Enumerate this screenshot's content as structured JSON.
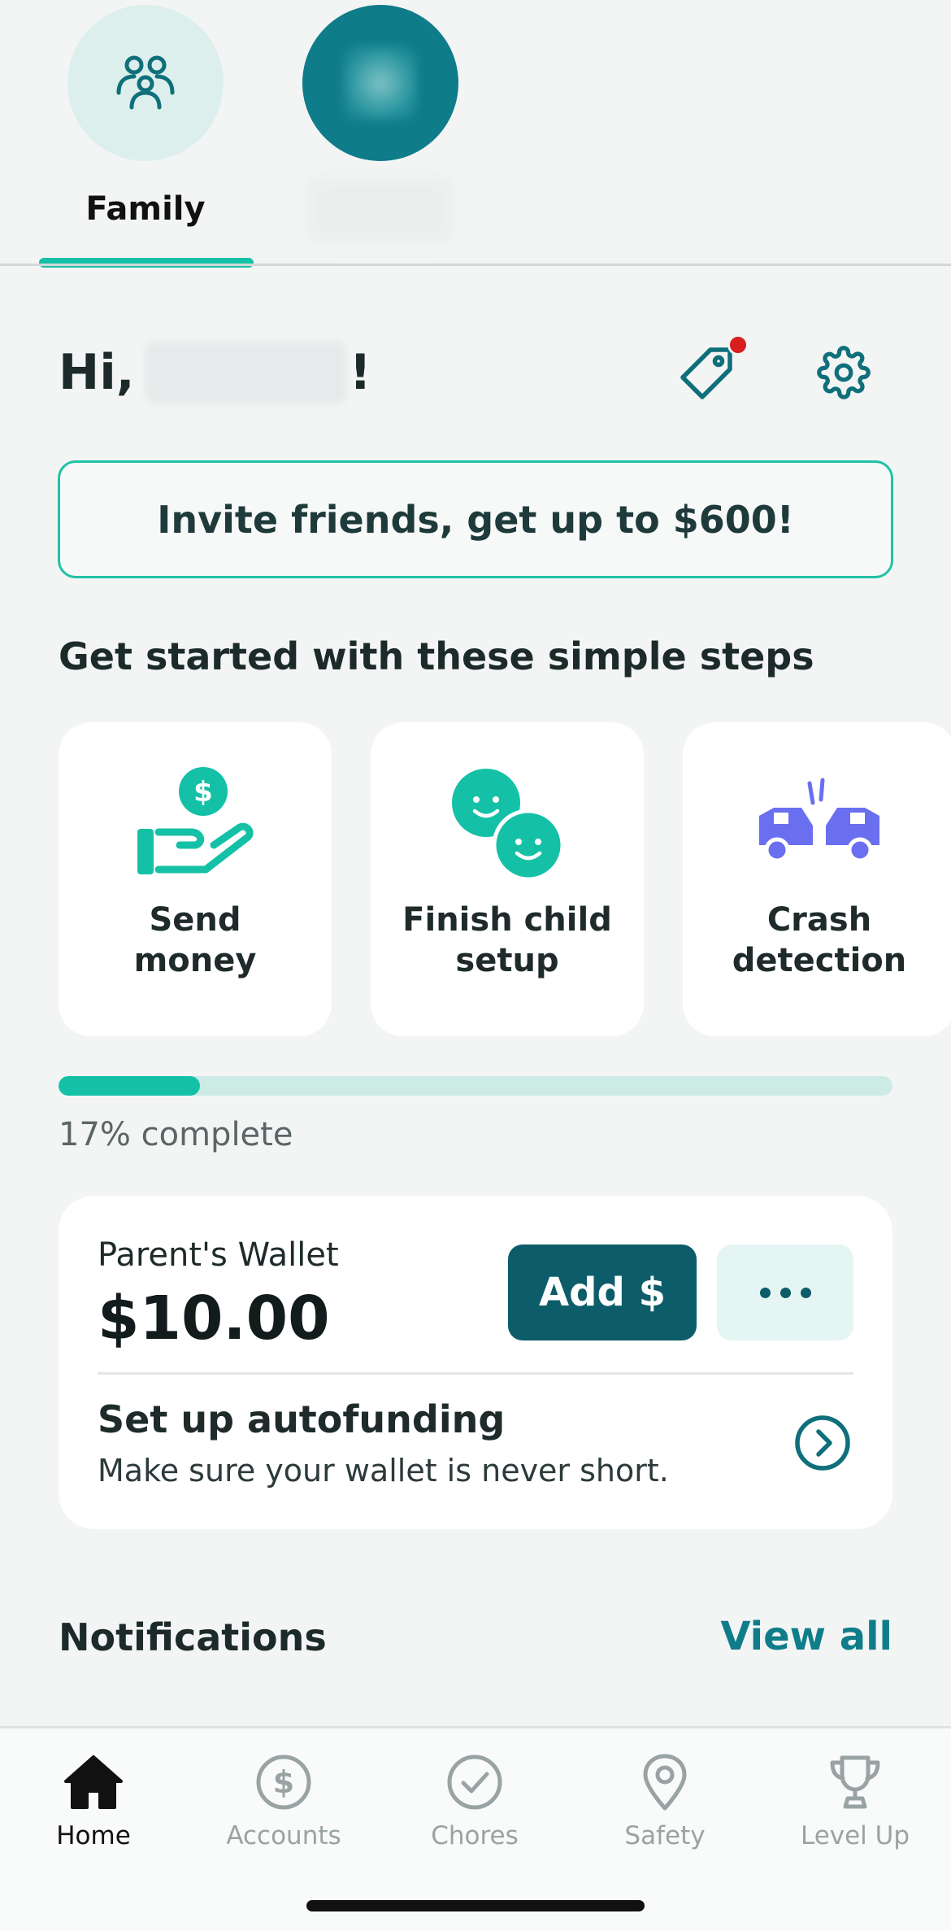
{
  "profiles": {
    "family_label": "Family",
    "child_label": ""
  },
  "greeting": {
    "prefix": "Hi,",
    "suffix": "!"
  },
  "invite_banner": "Invite friends, get up to $600!",
  "steps": {
    "title": "Get started with these simple steps",
    "cards": [
      {
        "label": "Send\nmoney",
        "icon": "send-money-icon"
      },
      {
        "label": "Finish child\nsetup",
        "icon": "faces-icon"
      },
      {
        "label": "Crash\ndetection",
        "icon": "crash-cars-icon"
      }
    ],
    "progress_fraction": 0.17,
    "progress_text": "17% complete"
  },
  "wallet": {
    "label": "Parent's Wallet",
    "amount": "$10.00",
    "add_label": "Add $",
    "autofund_title": "Set up autofunding",
    "autofund_subtitle": "Make sure your wallet is never short."
  },
  "notifications": {
    "title": "Notifications",
    "view_all": "View all"
  },
  "nav": [
    {
      "label": "Home",
      "icon": "home-icon",
      "active": true
    },
    {
      "label": "Accounts",
      "icon": "dollar-circle-icon",
      "active": false
    },
    {
      "label": "Chores",
      "icon": "check-circle-icon",
      "active": false
    },
    {
      "label": "Safety",
      "icon": "location-pin-icon",
      "active": false
    },
    {
      "label": "Level Up",
      "icon": "trophy-icon",
      "active": false
    }
  ],
  "colors": {
    "accent": "#14c1a6",
    "primary_dark": "#0c5d69",
    "link": "#0f7d89",
    "notification_dot": "#d71f1f",
    "crash_icon": "#6a6ff0"
  }
}
